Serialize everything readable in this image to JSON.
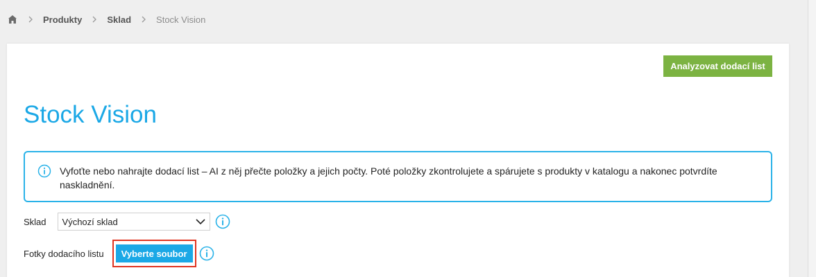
{
  "breadcrumb": {
    "items": [
      {
        "label": "Produkty"
      },
      {
        "label": "Sklad"
      }
    ],
    "current": "Stock Vision"
  },
  "toolbar": {
    "analyze_label": "Analyzovat dodací list"
  },
  "page": {
    "title": "Stock Vision"
  },
  "info": {
    "text": "Vyfoťte nebo nahrajte dodací list – AI z něj přečte položky a jejich počty. Poté položky zkontrolujete a spárujete s produkty v katalogu a nakonec potvrdíte naskladnění."
  },
  "form": {
    "warehouse": {
      "label": "Sklad",
      "selected": "Výchozí sklad"
    },
    "photos": {
      "label": "Fotky dodacího listu",
      "button_label": "Vyberte soubor"
    }
  },
  "colors": {
    "accent": "#1ba8e6",
    "primary_button": "#7cb342",
    "highlight": "#e0331f",
    "background": "#efefef"
  },
  "icons": {
    "home": "home-icon",
    "separator": "chevron-right-icon",
    "info": "info-circle-icon",
    "dropdown": "chevron-down-icon"
  }
}
